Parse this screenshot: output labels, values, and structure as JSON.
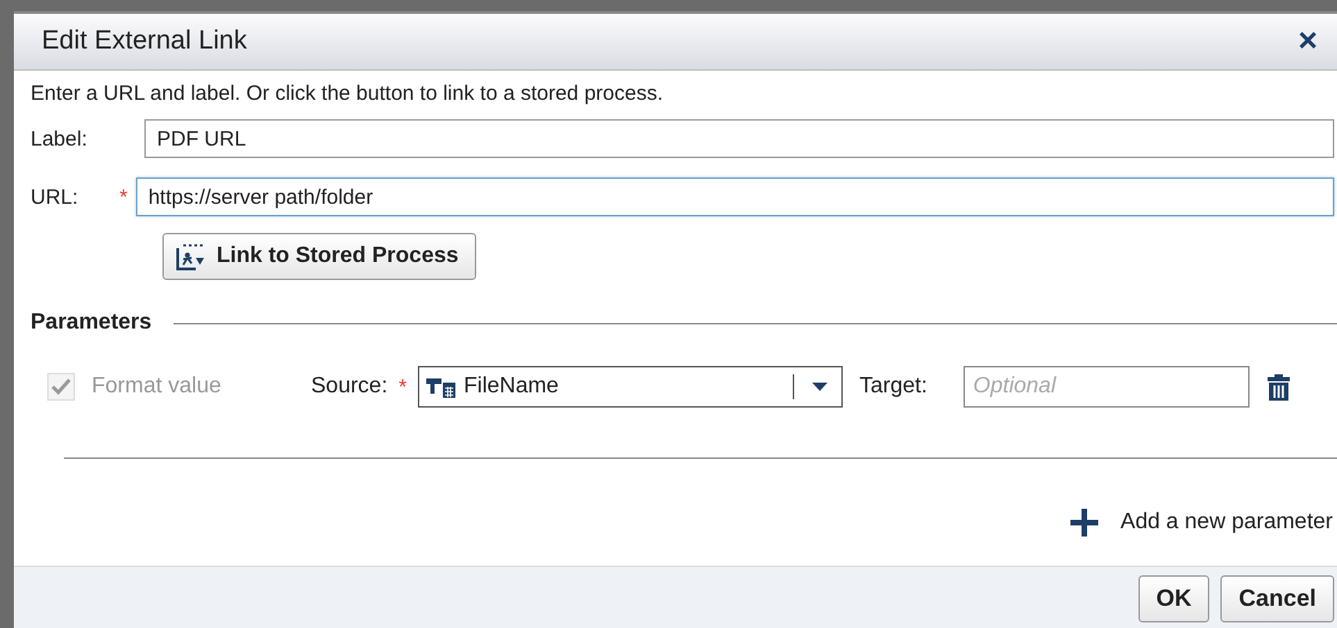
{
  "dialog": {
    "title": "Edit External Link",
    "close": "×"
  },
  "intro": "Enter a URL and label.  Or click the button to link to a stored process.",
  "fields": [
    {
      "label": "Label:",
      "value": "PDF URL",
      "focused": false
    },
    {
      "label": "URL:",
      "required_mark": "*",
      "value": "https://server path/folder",
      "focused": true
    }
  ],
  "stored_process_button": "Link to Stored Process",
  "parameters": {
    "heading": "Parameters",
    "rows": [
      {
        "format_value": {
          "label": "Format value",
          "checked": true,
          "disabled": true
        },
        "source_label": "Source:",
        "source_required_mark": "*",
        "source_value": "FileName",
        "target_label": "Target:",
        "target_placeholder": "Optional"
      }
    ],
    "add": "Add a new parameter"
  },
  "buttons": [
    "OK",
    "Cancel"
  ]
}
